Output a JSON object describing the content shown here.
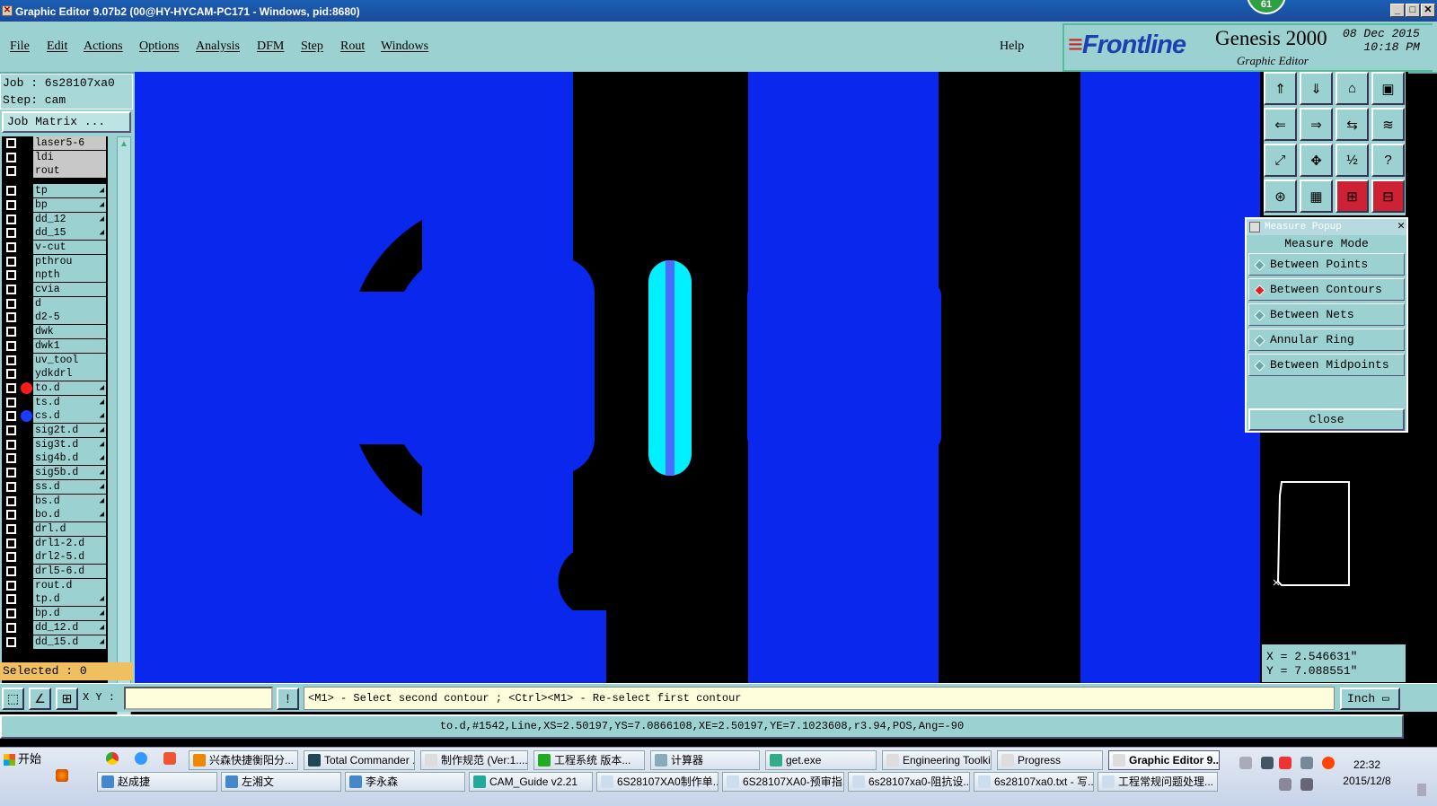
{
  "window": {
    "title": "Graphic Editor 9.07b2 (00@HY-HYCAM-PC171 - Windows, pid:8680)",
    "badge": "61",
    "min": "_",
    "max": "□",
    "close": "✕"
  },
  "menu": [
    "File",
    "Edit",
    "Actions",
    "Options",
    "Analysis",
    "DFM",
    "Step",
    "Rout",
    "Windows"
  ],
  "help": "Help",
  "brand": {
    "logo": "Frontline",
    "product": "Genesis 2000",
    "subtitle": "Graphic Editor",
    "date": "08 Dec 2015",
    "time": "10:18 PM"
  },
  "job": {
    "job_label": "Job : 6s28107xa0",
    "step_label": "Step: cam",
    "matrix_button": "Job Matrix ...",
    "selected": "Selected : 0"
  },
  "layers": [
    {
      "name": "laser5-6",
      "grey": true
    },
    {
      "name": "ldi",
      "grey": true
    },
    {
      "name": "rout",
      "grey": true
    },
    {
      "name": "tp",
      "arrow": true
    },
    {
      "name": "bp",
      "arrow": true
    },
    {
      "name": "dd_12",
      "arrow": true
    },
    {
      "name": "dd_15",
      "arrow": true
    },
    {
      "name": "v-cut"
    },
    {
      "name": "pthrou"
    },
    {
      "name": "npth"
    },
    {
      "name": "cvia"
    },
    {
      "name": "d"
    },
    {
      "name": "d2-5"
    },
    {
      "name": "dwk"
    },
    {
      "name": "dwk1"
    },
    {
      "name": "uv_tool"
    },
    {
      "name": "ydkdrl"
    },
    {
      "name": "to.d",
      "arrow": true,
      "dot": "#ff1a1a"
    },
    {
      "name": "ts.d",
      "arrow": true
    },
    {
      "name": "cs.d",
      "arrow": true,
      "dot": "#1a3cff"
    },
    {
      "name": "sig2t.d",
      "arrow": true
    },
    {
      "name": "sig3t.d",
      "arrow": true
    },
    {
      "name": "sig4b.d",
      "arrow": true
    },
    {
      "name": "sig5b.d",
      "arrow": true
    },
    {
      "name": "ss.d",
      "arrow": true
    },
    {
      "name": "bs.d",
      "arrow": true
    },
    {
      "name": "bo.d",
      "arrow": true
    },
    {
      "name": "drl.d"
    },
    {
      "name": "drl1-2.d"
    },
    {
      "name": "drl2-5.d"
    },
    {
      "name": "drl5-6.d"
    },
    {
      "name": "rout.d"
    },
    {
      "name": "tp.d",
      "arrow": true
    },
    {
      "name": "bp.d",
      "arrow": true
    },
    {
      "name": "dd_12.d",
      "arrow": true
    },
    {
      "name": "dd_15.d",
      "arrow": true
    }
  ],
  "measure": {
    "title": "Measure Popup",
    "mode_label": "Measure Mode",
    "options": [
      "Between Points",
      "Between Contours",
      "Between Nets",
      "Annular Ring",
      "Between Midpoints"
    ],
    "active": 1,
    "close": "Close"
  },
  "coords": {
    "x": "X = 2.546631\"",
    "y": "Y = 7.088551\""
  },
  "cmd": {
    "xy_label": "X Y :",
    "xy_value": "",
    "prompt": "<M1> - Select second contour ; <Ctrl><M1> - Re-select first contour",
    "units": "Inch"
  },
  "info": "to.d,#1542,Line,XS=2.50197,YS=7.0866108,XE=2.50197,YE=7.1023608,r3.94,POS,Ang=-90",
  "taskbar": {
    "start": "开始",
    "row1": [
      "兴森快捷衡阳分...",
      "Total Commander ...",
      "制作规范 (Ver:1....",
      "工程系统  版本...",
      "计算器",
      "get.exe",
      "Engineering Toolki...",
      "Progress",
      "Graphic Editor 9...."
    ],
    "row2": [
      "赵成捷",
      "左湘文",
      "李永森",
      "CAM_Guide v2.21",
      "6S28107XA0制作单....",
      "6S28107XA0-预审指...",
      "6s28107xa0-阻抗设...",
      "6s28107xa0.txt - 写...",
      "工程常规问题处理..."
    ],
    "clock_time": "22:32",
    "clock_date": "2015/12/8"
  },
  "colors": {
    "canvas": "#0a27ee",
    "panel": "#9cd1d1",
    "copper": "#000000",
    "highlight": "#00f0ff"
  }
}
